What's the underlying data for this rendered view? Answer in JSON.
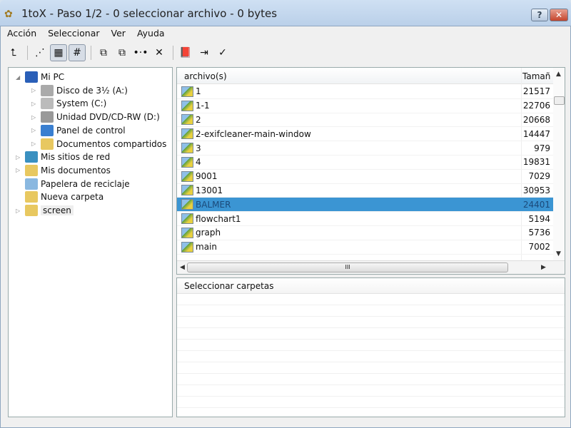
{
  "window": {
    "title": "1toX - Paso 1/2 - 0 seleccionar archivo - 0 bytes",
    "help": "?",
    "close": "✕"
  },
  "menu": [
    "Acción",
    "Seleccionar",
    "Ver",
    "Ayuda"
  ],
  "toolbar": [
    {
      "name": "folder-up-icon",
      "glyph": "⮤"
    },
    {
      "sep": true
    },
    {
      "name": "list-view-icon",
      "glyph": "⋰"
    },
    {
      "name": "details-view-icon",
      "glyph": "▦",
      "on": true
    },
    {
      "name": "grid-view-icon",
      "glyph": "#",
      "on": true
    },
    {
      "sep": true
    },
    {
      "name": "select-all-icon",
      "glyph": "⧉"
    },
    {
      "name": "invert-selection-icon",
      "glyph": "⧉"
    },
    {
      "name": "select-pattern-icon",
      "glyph": "•·•"
    },
    {
      "name": "deselect-icon",
      "glyph": "✕"
    },
    {
      "sep": true
    },
    {
      "name": "help-book-icon",
      "glyph": "📕"
    },
    {
      "name": "exit-icon",
      "glyph": "⇥"
    },
    {
      "name": "confirm-check-icon",
      "glyph": "✓"
    }
  ],
  "tree": [
    {
      "label": "Mi PC",
      "level": 0,
      "tw": "◢",
      "icon": "#2a5fb8"
    },
    {
      "label": "Disco de 3½ (A:)",
      "level": 1,
      "tw": "▷",
      "icon": "#aaa"
    },
    {
      "label": "System (C:)",
      "level": 1,
      "tw": "▷",
      "icon": "#bbb"
    },
    {
      "label": "Unidad DVD/CD-RW (D:)",
      "level": 1,
      "tw": "▷",
      "icon": "#999"
    },
    {
      "label": "Panel de control",
      "level": 1,
      "tw": "▷",
      "icon": "#3a7fd0"
    },
    {
      "label": "Documentos compartidos",
      "level": 1,
      "tw": "▷",
      "icon": "#e8c860"
    },
    {
      "label": "Mis sitios de red",
      "level": 0,
      "tw": "▷",
      "icon": "#3a90c0"
    },
    {
      "label": "Mis documentos",
      "level": 0,
      "tw": "▷",
      "icon": "#e8c860"
    },
    {
      "label": "Papelera de reciclaje",
      "level": 0,
      "tw": "",
      "icon": "#8ab8e0"
    },
    {
      "label": "Nueva carpeta",
      "level": 0,
      "tw": "",
      "icon": "#e8c860"
    },
    {
      "label": "screen",
      "level": 0,
      "tw": "▷",
      "icon": "#e8c860",
      "selected": true
    }
  ],
  "files": {
    "col_name": "archivo(s)",
    "col_size": "Tamañ",
    "rows": [
      {
        "name": "1",
        "size": "21517"
      },
      {
        "name": "1-1",
        "size": "22706"
      },
      {
        "name": "2",
        "size": "20668"
      },
      {
        "name": "2-exifcleaner-main-window",
        "size": "14447"
      },
      {
        "name": "3",
        "size": "979"
      },
      {
        "name": "4",
        "size": "19831"
      },
      {
        "name": "9001",
        "size": "7029"
      },
      {
        "name": "13001",
        "size": "30953"
      },
      {
        "name": "BALMER",
        "size": "24401",
        "selected": true
      },
      {
        "name": "flowchart1",
        "size": "5194"
      },
      {
        "name": "graph",
        "size": "5736"
      },
      {
        "name": "main",
        "size": "7002"
      }
    ],
    "hscroll_grip": "III"
  },
  "folders": {
    "header": "Seleccionar carpetas"
  },
  "colors": {
    "selection": "#3b95d3"
  }
}
